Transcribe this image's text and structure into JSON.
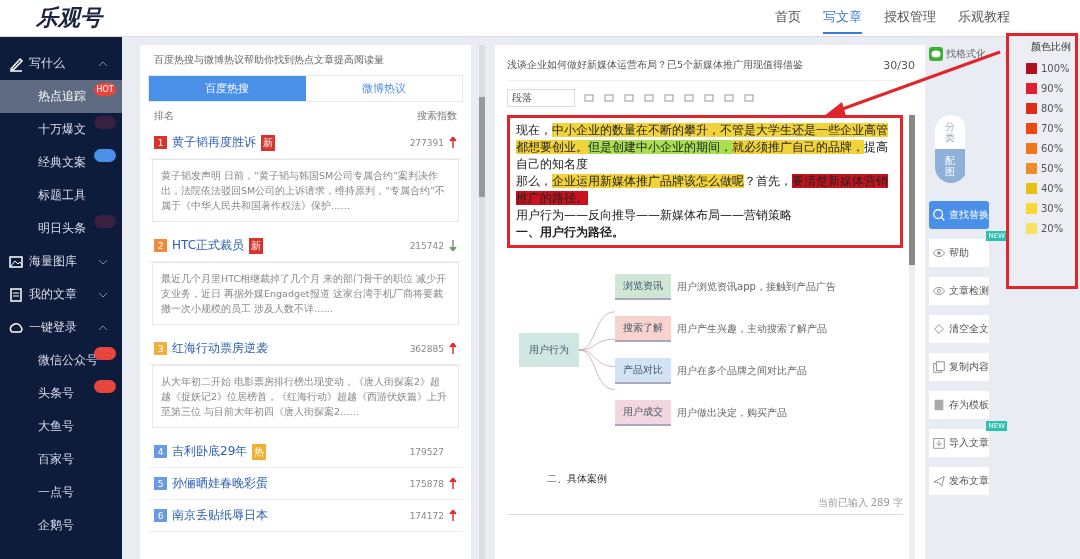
{
  "header": {
    "logo": "乐观号",
    "nav": [
      {
        "label": "首页",
        "selected": false
      },
      {
        "label": "写文章",
        "selected": true
      },
      {
        "label": "授权管理",
        "selected": false
      },
      {
        "label": "乐观教程",
        "selected": false
      }
    ]
  },
  "sidebar": {
    "items": [
      {
        "label": "写什么",
        "kind": "group",
        "expanded": true
      },
      {
        "label": "热点追踪",
        "kind": "sub",
        "selected": true,
        "badge": {
          "text": "HOT",
          "color": "#e8453c"
        }
      },
      {
        "label": "十万爆文",
        "kind": "sub",
        "selected": false,
        "badge": {
          "color": "#3a2040"
        }
      },
      {
        "label": "经典文案",
        "kind": "sub",
        "selected": false,
        "badge": {
          "color": "#4a8fe8"
        }
      },
      {
        "label": "标题工具",
        "kind": "sub",
        "selected": false
      },
      {
        "label": "明日头条",
        "kind": "sub",
        "selected": false,
        "badge": {
          "color": "#3a2040"
        }
      },
      {
        "label": "海量图库",
        "kind": "group",
        "expanded": false
      },
      {
        "label": "我的文章",
        "kind": "group",
        "expanded": false
      },
      {
        "label": "一键登录",
        "kind": "group",
        "expanded": true
      },
      {
        "label": "微信公众号",
        "kind": "sub",
        "selected": false,
        "badge": {
          "color": "#e8453c"
        }
      },
      {
        "label": "头条号",
        "kind": "sub",
        "selected": false,
        "badge": {
          "color": "#e8453c"
        }
      },
      {
        "label": "大鱼号",
        "kind": "sub",
        "selected": false
      },
      {
        "label": "百家号",
        "kind": "sub",
        "selected": false
      },
      {
        "label": "一点号",
        "kind": "sub",
        "selected": false
      },
      {
        "label": "企鹅号",
        "kind": "sub",
        "selected": false
      }
    ]
  },
  "hot": {
    "intro": "百度热搜与微博热议帮助你找到热点文章提高阅读量",
    "tabs": [
      {
        "label": "百度热搜",
        "selected": true
      },
      {
        "label": "微博热议",
        "selected": false
      }
    ],
    "columns": [
      "排名",
      "搜索指数"
    ],
    "items": [
      {
        "rank": "1",
        "color": "#d9342b",
        "title": "黄子韬再度胜诉",
        "tag": {
          "text": "新",
          "color": "#d9342b"
        },
        "index": "277391",
        "rising": true,
        "summary": "黄子韬发声明 日前，“黄子韬与韩国SM公司专属合约”案判决作出，法院依法驳回SM公司的上诉请求，维持原判，“专属合约”不属于《中华人民共和国著作权法》保护……"
      },
      {
        "rank": "2",
        "color": "#f08a3c",
        "title": "HTC正式裁员",
        "tag": {
          "text": "新",
          "color": "#d9342b"
        },
        "index": "215742",
        "rising": false,
        "summary": "最近几个月里HTC相继裁掉了几个月 来的部门骨干的职位 减少开支业务，近日 再据外媒Engadget报道 这家台湾手机厂商将要裁撤一次小规模的员工 涉及人数不详……"
      },
      {
        "rank": "3",
        "color": "#f0b040",
        "title": "红海行动票房逆袭",
        "index": "362885",
        "rising": true,
        "summary": "从大年初二开始 电影票房排行榜出现变动，《唐人街探案2》超越《捉妖记2》位居榜首，《红海行动》超越《西游伏妖篇》上升至第三位 与目前大年初四《唐人街探案2……"
      },
      {
        "rank": "4",
        "color": "#6a9ae0",
        "title": "吉利卧底29年",
        "tag": {
          "text": "热",
          "color": "#f0b030"
        },
        "index": "179527"
      },
      {
        "rank": "5",
        "color": "#6a9ae0",
        "title": "孙俪晒娃春晚彩蛋",
        "index": "175878",
        "rising": true
      },
      {
        "rank": "6",
        "color": "#6a9ae0",
        "title": "南京丢贴纸辱日本",
        "index": "174172",
        "rising": true
      }
    ]
  },
  "editor": {
    "title": "浅谈企业如何做好新媒体运营布局？已5个新媒体推广用现值得借鉴",
    "count": "30/30",
    "paragraph_style": "段落",
    "paragraphs": [
      {
        "bold": false,
        "segments": [
          {
            "text": "现在，"
          },
          {
            "text": "中小企业的数量在不断的攀升，不管是大学生还是一些企业高管都想要创业。",
            "color": "#f2d43a"
          },
          {
            "text": "但是创建中小企业的期间，",
            "color": "#a8e050"
          },
          {
            "text": "就必须推广自己的品牌，",
            "color": "#f2d43a"
          },
          {
            "text": "提高自己的知名度"
          }
        ]
      },
      {
        "bold": false,
        "segments": [
          {
            "text": "那么，"
          },
          {
            "text": "企业运用新媒体推广品牌该怎么做呢",
            "color": "#f2d43a"
          },
          {
            "text": "？首先，"
          },
          {
            "text": "要清楚新媒体营销推广的路径。",
            "color": "#c8121e"
          }
        ]
      },
      {
        "bold": false,
        "segments": [
          {
            "text": "用户行为——反向推导——新媒体布局——营销策略"
          }
        ]
      },
      {
        "bold": true,
        "segments": [
          {
            "text": "一、用户行为路径。"
          }
        ]
      }
    ],
    "mindmap": {
      "root": "用户行为",
      "branches": [
        {
          "label": "浏览资讯",
          "color": "#cfe6d6",
          "note": "用户浏览资讯app，接触到产品广告"
        },
        {
          "label": "搜索了解",
          "color": "#f6d3cc",
          "note": "用户产生兴趣，主动搜索了解产品"
        },
        {
          "label": "产品对比",
          "color": "#d3e3f6",
          "note": "用户在多个品牌之间对比产品"
        },
        {
          "label": "用户成交",
          "color": "#f3d7e0",
          "note": "用户做出决定，购买产品"
        }
      ]
    },
    "subheading": "二、具体案例",
    "footer": "当前已输入 289 字"
  },
  "tools": {
    "wechat_label": "找格式化",
    "side_tabs": [
      {
        "label": "分类",
        "selected": false
      },
      {
        "label": "配图",
        "selected": true
      }
    ],
    "buttons": [
      {
        "label": "查找替换",
        "kind": "primary"
      },
      {
        "label": "帮助",
        "kind": "normal",
        "badge": "NEW"
      },
      {
        "label": "文章检测",
        "kind": "normal"
      },
      {
        "label": "清空全文",
        "kind": "normal"
      },
      {
        "label": "复制内容",
        "kind": "normal"
      },
      {
        "label": "存为模板",
        "kind": "normal"
      },
      {
        "label": "导入文章",
        "kind": "normal",
        "badge": "NEW"
      },
      {
        "label": "发布文章",
        "kind": "normal"
      }
    ]
  },
  "legend": {
    "title": "颜色比例",
    "levels": [
      {
        "label": "100%",
        "color": "#b0101c"
      },
      {
        "label": "90%",
        "color": "#e02030"
      },
      {
        "label": "80%",
        "color": "#e02a1a"
      },
      {
        "label": "70%",
        "color": "#f04810"
      },
      {
        "label": "60%",
        "color": "#f07818"
      },
      {
        "label": "50%",
        "color": "#f08c28"
      },
      {
        "label": "40%",
        "color": "#e8c010"
      },
      {
        "label": "30%",
        "color": "#f8d830"
      },
      {
        "label": "20%",
        "color": "#f8e060"
      }
    ]
  }
}
